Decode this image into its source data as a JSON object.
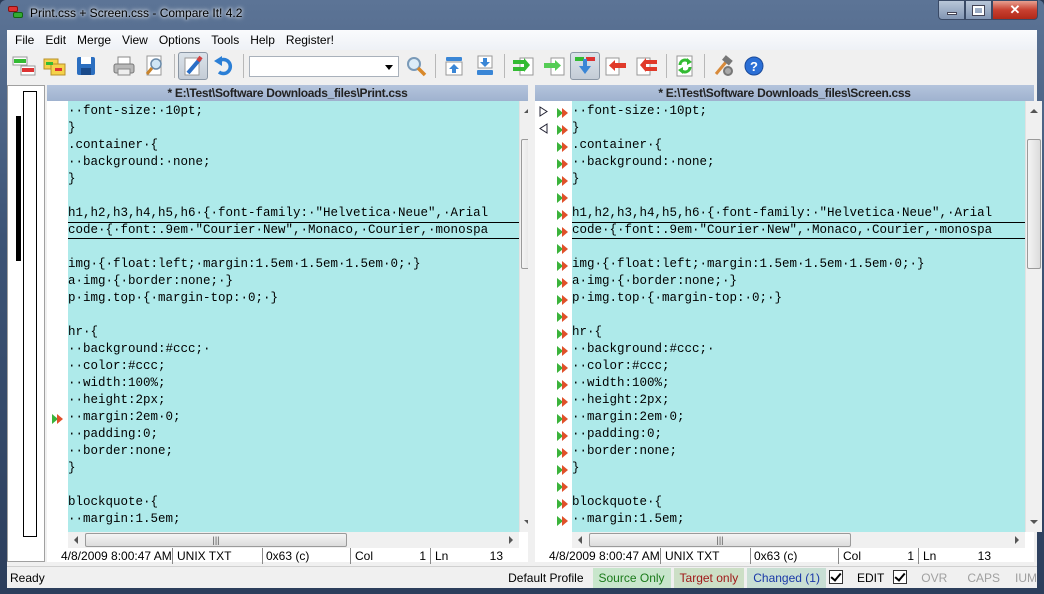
{
  "window": {
    "title": "Print.css + Screen.css - Compare It! 4.2",
    "controls": {
      "minimize": "—",
      "maximize": "▭",
      "close": "✕"
    }
  },
  "menu": [
    "File",
    "Edit",
    "Merge",
    "View",
    "Options",
    "Tools",
    "Help",
    "Register!"
  ],
  "toolbar": {
    "buttons": [
      {
        "name": "compare-files",
        "icon": "compare-icon"
      },
      {
        "name": "open-folders",
        "icon": "folder-compare-icon"
      },
      {
        "name": "save",
        "icon": "save-icon"
      },
      {
        "name": "print",
        "icon": "printer-icon"
      },
      {
        "name": "print-preview",
        "icon": "preview-icon"
      },
      {
        "name": "edit-mode",
        "icon": "pencil-icon",
        "active": true
      },
      {
        "name": "undo",
        "icon": "undo-icon"
      },
      {
        "name": "find",
        "icon": "search-icon"
      },
      {
        "name": "prev-change",
        "icon": "prev-change-icon"
      },
      {
        "name": "next-change",
        "icon": "next-change-icon"
      },
      {
        "name": "copy-all-right",
        "icon": "copy-all-right-icon"
      },
      {
        "name": "copy-right",
        "icon": "copy-right-icon"
      },
      {
        "name": "auto-merge",
        "icon": "merge-down-icon",
        "active": true
      },
      {
        "name": "copy-left",
        "icon": "copy-left-icon"
      },
      {
        "name": "copy-all-left",
        "icon": "copy-all-left-icon"
      },
      {
        "name": "refresh",
        "icon": "refresh-icon"
      },
      {
        "name": "tools",
        "icon": "hammer-gear-icon"
      },
      {
        "name": "help",
        "icon": "help-icon"
      }
    ],
    "search_value": ""
  },
  "left_pane": {
    "header": "* E:\\Test\\Software Downloads_files\\Print.css",
    "lines": [
      "  font-size: 10pt;",
      "}",
      ".container {",
      "  background: none;",
      "}",
      "",
      "h1,h2,h3,h4,h5,h6 { font-family: \"Helvetica Neue\", Arial",
      "code { font:.9em \"Courier New\", Monaco, Courier, monospa",
      "",
      "img { float:left; margin:1.5em 1.5em 1.5em 0; }",
      "a img { border:none; }",
      "p img.top { margin-top: 0; }",
      "",
      "hr {",
      "  background:#ccc; ",
      "  color:#ccc;",
      "  width:100%;",
      "  height:2px;",
      "  margin:2em 0;",
      "  padding:0;",
      "  border:none;",
      "}",
      "",
      "blockquote {",
      "  margin:1.5em;"
    ],
    "current_line_index": 7,
    "marker_line_index": 18,
    "status": {
      "date": "4/8/2009  8:00:47 AM",
      "format": "UNIX TXT",
      "char": "0x63 (c)",
      "col_label": "Col",
      "col": "1",
      "ln_label": "Ln",
      "ln": "13"
    }
  },
  "right_pane": {
    "header": "* E:\\Test\\Software Downloads_files\\Screen.css",
    "lines": [
      "  font-size: 10pt;",
      "}",
      ".container {",
      "  background: none;",
      "}",
      "",
      "h1,h2,h3,h4,h5,h6 { font-family: \"Helvetica Neue\", Arial",
      "code { font:.9em \"Courier New\", Monaco, Courier, monospa",
      "",
      "img { float:left; margin:1.5em 1.5em 1.5em 0; }",
      "a img { border:none; }",
      "p img.top { margin-top: 0; }",
      "",
      "hr {",
      "  background:#ccc; ",
      "  color:#ccc;",
      "  width:100%;",
      "  height:2px;",
      "  margin:2em 0;",
      "  padding:0;",
      "  border:none;",
      "}",
      "",
      "blockquote {",
      "  margin:1.5em;"
    ],
    "current_line_index": 7,
    "block_start_index": 0,
    "block_end_index": 1,
    "status": {
      "date": "4/8/2009  8:00:47 AM",
      "format": "UNIX TXT",
      "char": "0x63 (c)",
      "col_label": "Col",
      "col": "1",
      "ln_label": "Ln",
      "ln": "13"
    }
  },
  "statusbar": {
    "ready": "Ready",
    "profile": "Default Profile",
    "source_only": "Source Only",
    "target_only": "Target only",
    "changed": "Changed (1)",
    "changed_checked": true,
    "edit": "EDIT",
    "edit_checked": true,
    "ovr": "OVR",
    "caps": "CAPS",
    "num": "IUM"
  },
  "colors": {
    "diff_background": "#aeeaea",
    "pane_header": "#a8b9d4",
    "source_only": "#1a7a1a",
    "target_only": "#a01818",
    "changed": "#1a38a8"
  }
}
